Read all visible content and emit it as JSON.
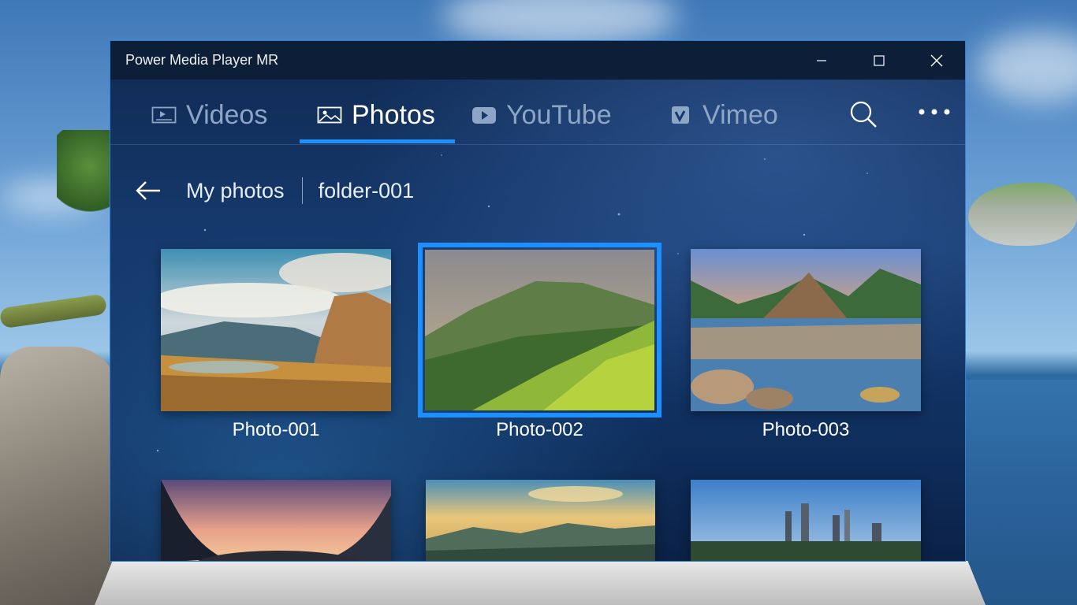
{
  "window": {
    "title": "Power Media Player MR",
    "controls": {
      "minimize": "minimize",
      "maximize": "maximize",
      "close": "close"
    }
  },
  "tabs": [
    {
      "label": "Videos",
      "icon": "video-icon",
      "active": false
    },
    {
      "label": "Photos",
      "icon": "photo-icon",
      "active": true
    },
    {
      "label": "YouTube",
      "icon": "youtube-icon",
      "active": false
    },
    {
      "label": "Vimeo",
      "icon": "vimeo-icon",
      "active": false
    }
  ],
  "toolbar": {
    "search_icon": "search-icon",
    "more_icon": "more-icon"
  },
  "breadcrumb": {
    "root": "My photos",
    "current": "folder-001"
  },
  "photos": [
    {
      "caption": "Photo-001",
      "selected": false
    },
    {
      "caption": "Photo-002",
      "selected": true
    },
    {
      "caption": "Photo-003",
      "selected": false
    },
    {
      "caption": "",
      "selected": false
    },
    {
      "caption": "",
      "selected": false
    },
    {
      "caption": "",
      "selected": false
    }
  ],
  "colors": {
    "accent": "#1e90ff",
    "titlebar": "#0d1f38",
    "inactive_tab": "#8ea6c6"
  }
}
